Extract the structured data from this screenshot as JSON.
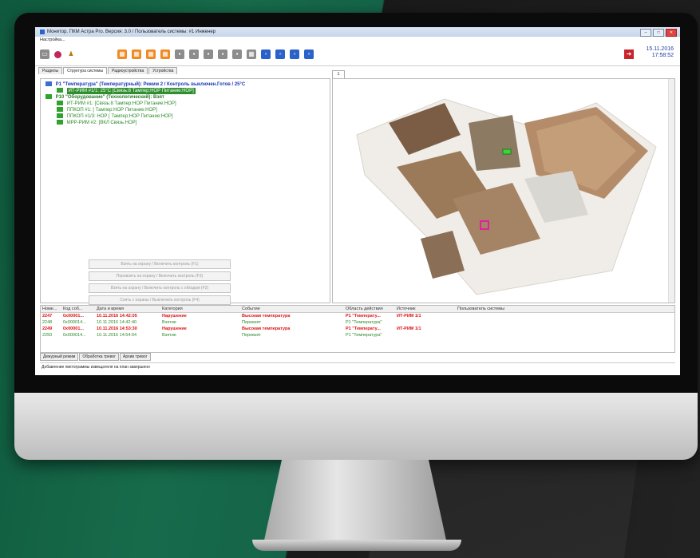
{
  "window": {
    "title": "Монитор. ПКМ Астра Pro. Версия: 3.0 / Пользователь системы: #1 Инженер",
    "datetime_date": "15.11.2016",
    "datetime_time": "17:58:52"
  },
  "menu": {
    "settings": "Настройка..."
  },
  "tabs": {
    "sections": "Разделы",
    "system_structure": "Структура системы",
    "radio_devices": "Радиоустройства",
    "devices": "Устройства",
    "plan": "1"
  },
  "tree": {
    "p1_title": "P1 \"Температура\" (Температурный): Режим 2 / Контроль выключен.Готов / 25°C",
    "p1_device": "ИТ-РИМ #1/1: 25°C [Связь:8 Тампер:НОР Питание:НОР]",
    "p10_title": "P10 \"Оборудование\" (Технологический): Взят",
    "items": [
      "ИТ-РИМ #1: [Связь:8 Тампер:НОР Питание:НОР]",
      "ППКОП #1: [ Тампер:НОР Питание:НОР]",
      "ППКОП #1/3: НОР [ Тампер:НОР Питание:НОР]",
      "МРР-РИМ #2: [ВКЛ Связь:НОР]"
    ]
  },
  "actions": [
    "Взять на охрану / Включить контроль (F1)",
    "Перевзять на охрану / Включить контроль (F3)",
    "Взять на охрану / Включить контроль с обходом (F2)",
    "Снять с охраны / Выключить контроль (F4)"
  ],
  "events": {
    "headers": [
      "Номе...",
      "Код соб...",
      "Дата и время",
      "Категория",
      "Событие",
      "Область действия",
      "Источник",
      "Пользователь системы"
    ],
    "rows": [
      {
        "num": "2247",
        "code": "0x00001...",
        "datetime": "10.11.2016 14:42:05",
        "category": "Нарушение",
        "event": "Высокая температура",
        "area": "P1 \"Температу...",
        "source": "ИТ-РИМ 1/1",
        "user": "",
        "type": "alarm"
      },
      {
        "num": "2248",
        "code": "0x000014...",
        "datetime": "10.11.2016 14:42:40",
        "category": "Взятие",
        "event": "Перевзят",
        "area": "P1 \"Температура\"",
        "source": "",
        "user": "",
        "type": "ok"
      },
      {
        "num": "2249",
        "code": "0x00001...",
        "datetime": "10.11.2016 14:53:30",
        "category": "Нарушение",
        "event": "Высокая температура",
        "area": "P1 \"Температу...",
        "source": "ИТ-РИМ 1/1",
        "user": "",
        "type": "alarm"
      },
      {
        "num": "2250",
        "code": "0x000014...",
        "datetime": "10.11.2016 14:54:04",
        "category": "Взятие",
        "event": "Перевзят",
        "area": "P1 \"Температура\"",
        "source": "",
        "user": "",
        "type": "ok"
      }
    ]
  },
  "bottom_tabs": [
    "Дежурный режим",
    "Обработка тревог",
    "Архив тревог"
  ],
  "status": "Добавление пиктограммы извещателя на план завершено"
}
